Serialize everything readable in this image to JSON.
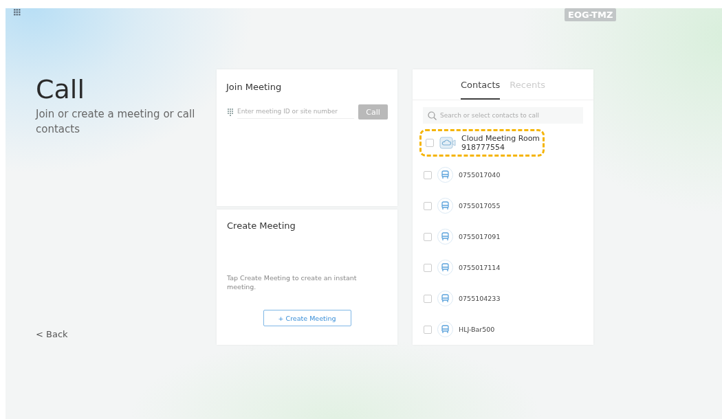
{
  "device_name": "EOG-TMZ",
  "page": {
    "title": "Call",
    "subtitle": "Join or create a meeting or call contacts",
    "back": "< Back"
  },
  "join_meeting": {
    "title": "Join Meeting",
    "field": {
      "placeholder": "Enter meeting ID or site number"
    },
    "call_button": {
      "label": "Call",
      "disabled": true
    }
  },
  "create_meeting": {
    "title": "Create Meeting",
    "description": "Tap Create Meeting to create an instant meeting.",
    "button": "+ Create Meeting"
  },
  "contacts_panel": {
    "tabs": [
      {
        "label": "Contacts",
        "selected": true
      },
      {
        "label": "Recents",
        "selected": false
      }
    ],
    "search": {
      "placeholder": "Search or select contacts to call"
    },
    "contacts": [
      {
        "kind": "cloud-room",
        "name": "Cloud Meeting Room",
        "number": "918777554",
        "checked": false,
        "highlighted": true
      },
      {
        "kind": "terminal",
        "name": "0755017040",
        "checked": false,
        "highlighted": false
      },
      {
        "kind": "terminal",
        "name": "0755017055",
        "checked": false,
        "highlighted": false
      },
      {
        "kind": "terminal",
        "name": "0755017091",
        "checked": false,
        "highlighted": false
      },
      {
        "kind": "terminal",
        "name": "0755017114",
        "checked": false,
        "highlighted": false
      },
      {
        "kind": "terminal",
        "name": "0755104233",
        "checked": false,
        "highlighted": false
      },
      {
        "kind": "terminal",
        "name": "HLJ-Bar500",
        "checked": false,
        "highlighted": false
      }
    ]
  }
}
